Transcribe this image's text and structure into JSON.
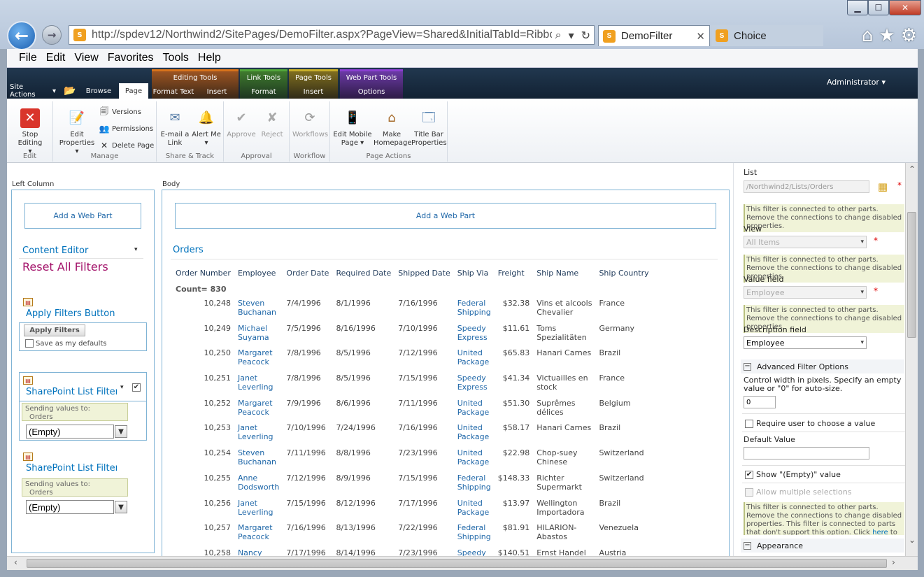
{
  "browser": {
    "url": "http://spdev12/Northwind2/SitePages/DemoFilter.aspx?PageView=Shared&InitialTabId=Ribbon",
    "tabs": [
      {
        "label": "DemoFilter"
      },
      {
        "label": "Choice"
      }
    ],
    "menu": [
      "File",
      "Edit",
      "View",
      "Favorites",
      "Tools",
      "Help"
    ]
  },
  "ribbon": {
    "site_actions": "Site Actions",
    "tabs": {
      "browse": "Browse",
      "page": "Page"
    },
    "contexts": [
      {
        "label": "Editing Tools",
        "tabs": [
          "Format Text",
          "Insert"
        ],
        "color": "#d8731b"
      },
      {
        "label": "Link Tools",
        "tabs": [
          "Format"
        ],
        "color": "#52a73b"
      },
      {
        "label": "Page Tools",
        "tabs": [
          "Insert"
        ],
        "color": "#c9b02a"
      },
      {
        "label": "Web Part Tools",
        "tabs": [
          "Options"
        ],
        "color": "#8a3fd1"
      }
    ],
    "user": "Administrator",
    "groups": {
      "edit": {
        "label": "Edit",
        "stop_editing": "Stop Editing"
      },
      "manage": {
        "label": "Manage",
        "edit_properties": "Edit Properties",
        "versions": "Versions",
        "permissions": "Permissions",
        "delete_page": "Delete Page"
      },
      "share": {
        "label": "Share & Track",
        "email": "E-mail a Link",
        "alert": "Alert Me"
      },
      "approval": {
        "label": "Approval",
        "approve": "Approve",
        "reject": "Reject"
      },
      "workflow": {
        "label": "Workflow",
        "workflows": "Workflows"
      },
      "page_actions": {
        "label": "Page Actions",
        "mobile": "Edit Mobile Page",
        "homepage": "Make Homepage",
        "titlebar": "Title Bar Properties"
      }
    }
  },
  "left_column": {
    "zone_label": "Left Column",
    "add_web_part": "Add a Web Part",
    "content_editor": "Content Editor",
    "reset_filters": "Reset All Filters",
    "apply_title": "Apply Filters Button",
    "apply_button": "Apply Filters",
    "save_defaults": "Save as my defaults",
    "filter1_title": "SharePoint List Filter",
    "filter2_title": "SharePoint List Filter",
    "sending_label": "Sending values to:",
    "sending_target": "Orders",
    "empty_value": "(Empty)"
  },
  "body": {
    "zone_label": "Body",
    "add_web_part": "Add a Web Part",
    "list_title": "Orders",
    "columns": [
      "Order Number",
      "Employee",
      "Order Date",
      "Required Date",
      "Shipped Date",
      "Ship Via",
      "Freight",
      "Ship Name",
      "Ship Country"
    ],
    "count": "Count= 830",
    "rows": [
      [
        "10,248",
        "Steven",
        "Buchanan",
        "7/4/1996",
        "8/1/1996",
        "7/16/1996",
        "Federal",
        "Shipping",
        "$32.38",
        "Vins et alcools",
        "Chevalier",
        "France"
      ],
      [
        "10,249",
        "Michael",
        "Suyama",
        "7/5/1996",
        "8/16/1996",
        "7/10/1996",
        "Speedy",
        "Express",
        "$11.61",
        "Toms",
        "Spezialitäten",
        "Germany"
      ],
      [
        "10,250",
        "Margaret",
        "Peacock",
        "7/8/1996",
        "8/5/1996",
        "7/12/1996",
        "United",
        "Package",
        "$65.83",
        "Hanari Carnes",
        "",
        "Brazil"
      ],
      [
        "10,251",
        "Janet",
        "Leverling",
        "7/8/1996",
        "8/5/1996",
        "7/15/1996",
        "Speedy",
        "Express",
        "$41.34",
        "Victuailles en",
        "stock",
        "France"
      ],
      [
        "10,252",
        "Margaret",
        "Peacock",
        "7/9/1996",
        "8/6/1996",
        "7/11/1996",
        "United",
        "Package",
        "$51.30",
        "Suprêmes",
        "délices",
        "Belgium"
      ],
      [
        "10,253",
        "Janet",
        "Leverling",
        "7/10/1996",
        "7/24/1996",
        "7/16/1996",
        "United",
        "Package",
        "$58.17",
        "Hanari Carnes",
        "",
        "Brazil"
      ],
      [
        "10,254",
        "Steven",
        "Buchanan",
        "7/11/1996",
        "8/8/1996",
        "7/23/1996",
        "United",
        "Package",
        "$22.98",
        "Chop-suey",
        "Chinese",
        "Switzerland"
      ],
      [
        "10,255",
        "Anne",
        "Dodsworth",
        "7/12/1996",
        "8/9/1996",
        "7/15/1996",
        "Federal",
        "Shipping",
        "$148.33",
        "Richter",
        "Supermarkt",
        "Switzerland"
      ],
      [
        "10,256",
        "Janet",
        "Leverling",
        "7/15/1996",
        "8/12/1996",
        "7/17/1996",
        "United",
        "Package",
        "$13.97",
        "Wellington",
        "Importadora",
        "Brazil"
      ],
      [
        "10,257",
        "Margaret",
        "Peacock",
        "7/16/1996",
        "8/13/1996",
        "7/22/1996",
        "Federal",
        "Shipping",
        "$81.91",
        "HILARION-",
        "Abastos",
        "Venezuela"
      ],
      [
        "10,258",
        "Nancy",
        "",
        "7/17/1996",
        "8/14/1996",
        "7/23/1996",
        "Speedy",
        "",
        "$140.51",
        "Ernst Handel",
        "",
        "Austria"
      ]
    ]
  },
  "toolpane": {
    "list_label": "List",
    "list_value": "/Northwind2/Lists/Orders",
    "note": "This filter is connected to other parts. Remove the connections to change disabled properties.",
    "view_label": "View",
    "view_value": "All Items",
    "value_field_label": "Value field",
    "value_field_value": "Employee",
    "description_label": "Description field",
    "description_value": "Employee",
    "advanced_label": "Advanced Filter Options",
    "width_label": "Control width in pixels. Specify an empty value or \"0\" for auto-size.",
    "width_value": "0",
    "require_label": "Require user to choose a value",
    "default_label": "Default Value",
    "show_empty_label": "Show \"(Empty)\" value",
    "allow_multiple_label": "Allow multiple selections",
    "note2_part1": "This filter is connected to other parts. Remove the connections to change disabled properties.",
    "note2_part2": "This filter is connected to parts that don't support this option. Click",
    "note2_link": "here",
    "note2_part3": "to display unsupported parts",
    "appearance_label": "Appearance"
  }
}
